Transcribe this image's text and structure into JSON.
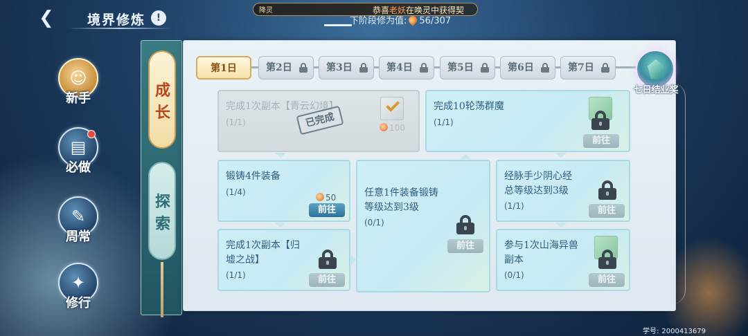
{
  "header": {
    "back_glyph": "❮",
    "title": "境界修炼",
    "info_glyph": "!",
    "announcement": {
      "tag": "降灵",
      "text_prefix": "恭喜",
      "highlight": "老妖",
      "text_suffix": "在唤灵中获得契",
      "text": "恭喜老妖在唤灵中获得契"
    },
    "cultivation_label": "下阶段修为值:",
    "cultivation_value": "56/307"
  },
  "nav": [
    {
      "label": "新手",
      "icon": "novice-icon",
      "glyph": "☺",
      "active": true,
      "badge": false
    },
    {
      "label": "必做",
      "icon": "scroll-icon",
      "glyph": "▤",
      "active": false,
      "badge": true
    },
    {
      "label": "周常",
      "icon": "book-icon",
      "glyph": "✎",
      "active": false,
      "badge": false
    },
    {
      "label": "修行",
      "icon": "meditation-icon",
      "glyph": "✦",
      "active": false,
      "badge": false
    }
  ],
  "vtabs": {
    "grow": "成长",
    "explore": "探索"
  },
  "days": [
    {
      "label": "第1日",
      "locked": false,
      "active": true
    },
    {
      "label": "第2日",
      "locked": true
    },
    {
      "label": "第3日",
      "locked": true
    },
    {
      "label": "第4日",
      "locked": true
    },
    {
      "label": "第5日",
      "locked": true
    },
    {
      "label": "第6日",
      "locked": true
    },
    {
      "label": "第7日",
      "locked": true
    }
  ],
  "final_reward": {
    "label": "七日结业奖",
    "icon": "gem-icon"
  },
  "tasks": {
    "t1": {
      "title": "完成1次副本【青云幻境】",
      "progress": "(1/1)",
      "reward": "100",
      "stamp": "已完成",
      "status": "done"
    },
    "t2": {
      "title": "完成10轮荡群魔",
      "progress": "(1/1)",
      "button": "前往",
      "status": "locked"
    },
    "t3": {
      "title": "锻铸4件装备",
      "progress": "(1/4)",
      "reward": "50",
      "button": "前往",
      "status": "active"
    },
    "t4": {
      "title_line1": "任意1件装备锻铸",
      "title_line2": "等级达到3级",
      "progress": "(0/1)",
      "button": "前往",
      "status": "locked"
    },
    "t5": {
      "title_line1": "经脉手少阴心经",
      "title_line2": "总等级达到3级",
      "progress": "(1/1)",
      "button": "前往",
      "status": "locked"
    },
    "t6": {
      "title_line1": "完成1次副本【归",
      "title_line2": "墟之战】",
      "progress": "(1/1)",
      "button": "前往",
      "status": "locked"
    },
    "t7": {
      "title_line1": "参与1次山海异兽",
      "title_line2": "副本",
      "progress": "(0/1)",
      "button": "前往",
      "status": "locked"
    }
  },
  "footer": {
    "student_id_label": "学号:",
    "student_id": "2000413679"
  }
}
